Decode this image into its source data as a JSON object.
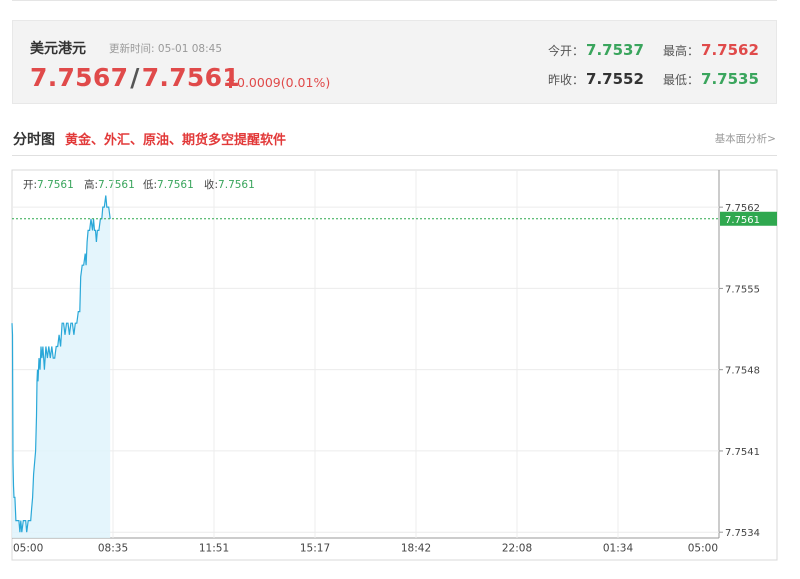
{
  "quote": {
    "name": "美元港元",
    "update_label": "更新时间:",
    "update_time": "05-01 08:45",
    "bid": "7.7567",
    "slash": "/",
    "ask": "7.7561",
    "change": "0.0009(0.01%)",
    "stats": {
      "open_label": "今开：",
      "open_value": "7.7537",
      "high_label": "最高：",
      "high_value": "7.7562",
      "prev_close_label": "昨收：",
      "prev_close_value": "7.7552",
      "low_label": "最低：",
      "low_value": "7.7535"
    }
  },
  "section": {
    "title": "分时图",
    "promo": "黄金、外汇、原油、期货多空提醒软件",
    "more": "基本面分析>"
  },
  "ohlc": {
    "open_label": "开:",
    "open": "7.7561",
    "high_label": "高:",
    "high": "7.7561",
    "low_label": "低:",
    "low": "7.7561",
    "close_label": "收:",
    "close": "7.7561"
  },
  "colors": {
    "line": "#2aa8d8",
    "area": "#dff3fb",
    "current_price": "#2fa84f",
    "up": "#e04a4a"
  },
  "chart_data": {
    "type": "line",
    "xlabel": "",
    "ylabel": "",
    "x_ticks": [
      "05:00",
      "08:35",
      "11:51",
      "15:17",
      "18:42",
      "22:08",
      "01:34",
      "05:00"
    ],
    "y_ticks": [
      "7.7534",
      "7.7541",
      "7.7548",
      "7.7555",
      "7.7562"
    ],
    "ylim": [
      7.75335,
      7.75652
    ],
    "xlim_minutes": [
      0,
      1440
    ],
    "current_price": 7.7561,
    "current_price_label": "7.7561",
    "grid": true,
    "series": [
      {
        "points": [
          [
            0,
            7.7552
          ],
          [
            1,
            7.7551
          ],
          [
            2,
            7.754
          ],
          [
            3,
            7.7538
          ],
          [
            4,
            7.7537
          ],
          [
            6,
            7.7537
          ],
          [
            8,
            7.7535
          ],
          [
            11,
            7.7535
          ],
          [
            14,
            7.7535
          ],
          [
            16,
            7.7534
          ],
          [
            18,
            7.7535
          ],
          [
            20,
            7.7534
          ],
          [
            23,
            7.7535
          ],
          [
            26,
            7.7535
          ],
          [
            28,
            7.7535
          ],
          [
            30,
            7.7534
          ],
          [
            33,
            7.7535
          ],
          [
            35,
            7.7535
          ],
          [
            38,
            7.7535
          ],
          [
            40,
            7.7536
          ],
          [
            42,
            7.7537
          ],
          [
            44,
            7.7539
          ],
          [
            46,
            7.754
          ],
          [
            48,
            7.7541
          ],
          [
            50,
            7.7544
          ],
          [
            51,
            7.7547
          ],
          [
            52,
            7.7548
          ],
          [
            53,
            7.7547
          ],
          [
            55,
            7.7549
          ],
          [
            57,
            7.7548
          ],
          [
            59,
            7.755
          ],
          [
            61,
            7.7549
          ],
          [
            63,
            7.755
          ],
          [
            66,
            7.7548
          ],
          [
            69,
            7.755
          ],
          [
            72,
            7.7549
          ],
          [
            75,
            7.755
          ],
          [
            78,
            7.7549
          ],
          [
            81,
            7.755
          ],
          [
            84,
            7.7549
          ],
          [
            87,
            7.7549
          ],
          [
            90,
            7.755
          ],
          [
            93,
            7.755
          ],
          [
            96,
            7.7551
          ],
          [
            99,
            7.755
          ],
          [
            102,
            7.7552
          ],
          [
            105,
            7.7552
          ],
          [
            108,
            7.7551
          ],
          [
            111,
            7.7552
          ],
          [
            114,
            7.7552
          ],
          [
            117,
            7.7551
          ],
          [
            120,
            7.7552
          ],
          [
            123,
            7.7552
          ],
          [
            126,
            7.7551
          ],
          [
            129,
            7.7552
          ],
          [
            132,
            7.7552
          ],
          [
            135,
            7.7553
          ],
          [
            138,
            7.7553
          ],
          [
            140,
            7.7556
          ],
          [
            143,
            7.7557
          ],
          [
            146,
            7.7557
          ],
          [
            149,
            7.7558
          ],
          [
            151,
            7.7557
          ],
          [
            153,
            7.7559
          ],
          [
            155,
            7.756
          ],
          [
            158,
            7.756
          ],
          [
            161,
            7.7561
          ],
          [
            164,
            7.756
          ],
          [
            166,
            7.7561
          ],
          [
            168,
            7.756
          ],
          [
            170,
            7.756
          ],
          [
            172,
            7.7559
          ],
          [
            174,
            7.756
          ],
          [
            177,
            7.756
          ],
          [
            180,
            7.7561
          ],
          [
            183,
            7.7561
          ],
          [
            185,
            7.7562
          ],
          [
            188,
            7.7562
          ],
          [
            191,
            7.7563
          ],
          [
            193,
            7.7562
          ],
          [
            195,
            7.7562
          ],
          [
            197,
            7.7562
          ],
          [
            200,
            7.7561
          ]
        ]
      }
    ]
  }
}
